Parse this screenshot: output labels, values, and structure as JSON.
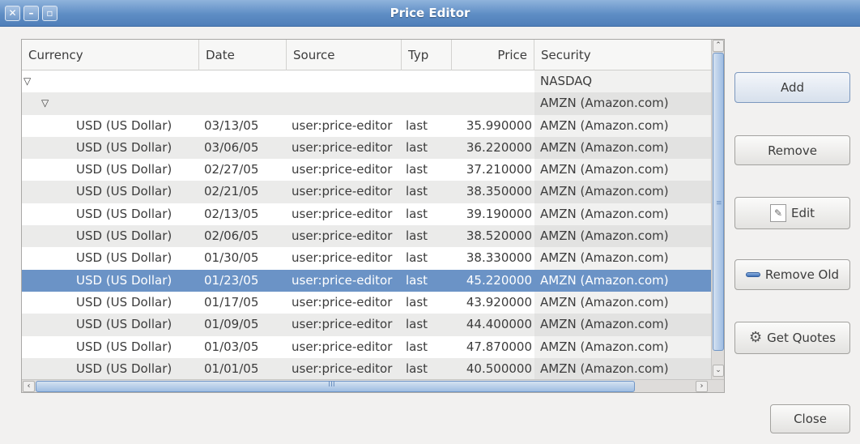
{
  "window": {
    "title": "Price Editor",
    "controls": [
      "close-icon",
      "minimize-icon",
      "maximize-icon"
    ]
  },
  "table": {
    "headers": {
      "currency": "Currency",
      "date": "Date",
      "source": "Source",
      "type": "Typ",
      "price": "Price",
      "security": "Security"
    },
    "groups": {
      "namespace": "NASDAQ",
      "commodity": "AMZN (Amazon.com)"
    },
    "rows": [
      {
        "currency": "USD (US Dollar)",
        "date": "03/13/05",
        "source": "user:price-editor",
        "type": "last",
        "price": "35.990000",
        "security": "AMZN (Amazon.com)"
      },
      {
        "currency": "USD (US Dollar)",
        "date": "03/06/05",
        "source": "user:price-editor",
        "type": "last",
        "price": "36.220000",
        "security": "AMZN (Amazon.com)"
      },
      {
        "currency": "USD (US Dollar)",
        "date": "02/27/05",
        "source": "user:price-editor",
        "type": "last",
        "price": "37.210000",
        "security": "AMZN (Amazon.com)"
      },
      {
        "currency": "USD (US Dollar)",
        "date": "02/21/05",
        "source": "user:price-editor",
        "type": "last",
        "price": "38.350000",
        "security": "AMZN (Amazon.com)"
      },
      {
        "currency": "USD (US Dollar)",
        "date": "02/13/05",
        "source": "user:price-editor",
        "type": "last",
        "price": "39.190000",
        "security": "AMZN (Amazon.com)"
      },
      {
        "currency": "USD (US Dollar)",
        "date": "02/06/05",
        "source": "user:price-editor",
        "type": "last",
        "price": "38.520000",
        "security": "AMZN (Amazon.com)"
      },
      {
        "currency": "USD (US Dollar)",
        "date": "01/30/05",
        "source": "user:price-editor",
        "type": "last",
        "price": "38.330000",
        "security": "AMZN (Amazon.com)"
      },
      {
        "currency": "USD (US Dollar)",
        "date": "01/23/05",
        "source": "user:price-editor",
        "type": "last",
        "price": "45.220000",
        "security": "AMZN (Amazon.com)"
      },
      {
        "currency": "USD (US Dollar)",
        "date": "01/17/05",
        "source": "user:price-editor",
        "type": "last",
        "price": "43.920000",
        "security": "AMZN (Amazon.com)"
      },
      {
        "currency": "USD (US Dollar)",
        "date": "01/09/05",
        "source": "user:price-editor",
        "type": "last",
        "price": "44.400000",
        "security": "AMZN (Amazon.com)"
      },
      {
        "currency": "USD (US Dollar)",
        "date": "01/03/05",
        "source": "user:price-editor",
        "type": "last",
        "price": "47.870000",
        "security": "AMZN (Amazon.com)"
      },
      {
        "currency": "USD (US Dollar)",
        "date": "01/01/05",
        "source": "user:price-editor",
        "type": "last",
        "price": "40.500000",
        "security": "AMZN (Amazon.com)"
      }
    ],
    "selected_row_index": 7
  },
  "buttons": {
    "add": "Add",
    "remove": "Remove",
    "edit": "Edit",
    "remove_old": "Remove Old",
    "get_quotes": "Get Quotes",
    "close": "Close"
  },
  "colors": {
    "titlebar": "#5e8dc4",
    "selection": "#6b93c6",
    "row_alt": "#ebebea"
  }
}
